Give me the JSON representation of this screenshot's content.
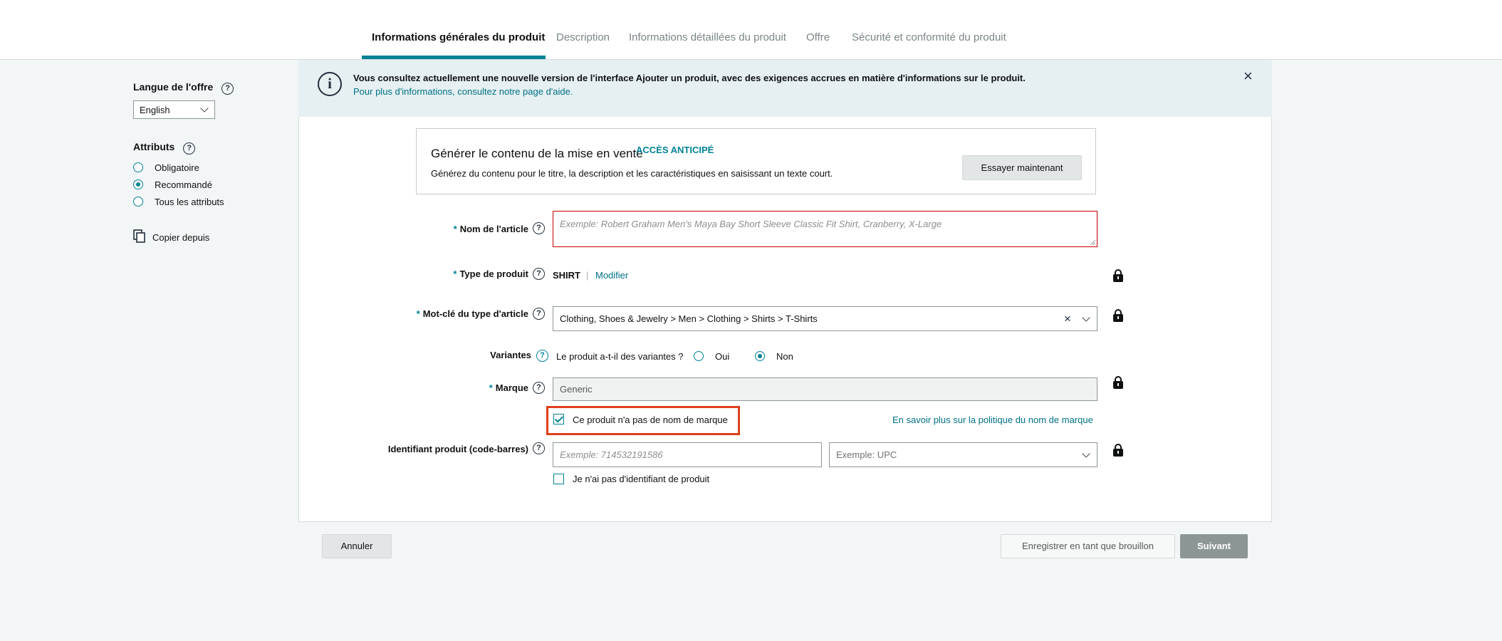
{
  "tabs": [
    {
      "label": "Informations générales du produit",
      "active": true
    },
    {
      "label": "Description"
    },
    {
      "label": "Informations détaillées du produit"
    },
    {
      "label": "Offre"
    },
    {
      "label": "Sécurité et conformité du produit"
    }
  ],
  "sidebar": {
    "language_title": "Langue de l'offre",
    "language_value": "English",
    "attributes_title": "Attributs",
    "attribute_options": [
      "Obligatoire",
      "Recommandé",
      "Tous les attributs"
    ],
    "attribute_selected": "Recommandé",
    "copy_label": "Copier depuis"
  },
  "banner": {
    "message": "Vous consultez actuellement une nouvelle version de l'interface Ajouter un produit, avec des exigences accrues en matière d'informations sur le produit.",
    "link": "Pour plus d'informations, consultez notre page d'aide.",
    "close": "×"
  },
  "generator": {
    "title": "Générer le contenu de la mise en vente",
    "badge": "ACCÈS ANTICIPÉ",
    "subtitle": "Générez du contenu pour le titre, la description et les caractéristiques en saisissant un texte court.",
    "button": "Essayer maintenant"
  },
  "form": {
    "required_mark": "*",
    "item_name": {
      "label": "Nom de l'article",
      "placeholder": "Exemple: Robert Graham Men's Maya Bay Short Sleeve Classic Fit Shirt, Cranberry, X-Large"
    },
    "product_type": {
      "label": "Type de produit",
      "value": "SHIRT",
      "separator": "|",
      "modify": "Modifier"
    },
    "keyword": {
      "label": "Mot-clé du type d'article",
      "value": "Clothing, Shoes & Jewelry > Men > Clothing > Shirts > T-Shirts",
      "clear": "×"
    },
    "variants": {
      "label": "Variantes",
      "question": "Le produit a-t-il des variantes ?",
      "yes": "Oui",
      "no": "Non",
      "selected": "Non"
    },
    "brand": {
      "label": "Marque",
      "value": "Generic",
      "no_brand_label": "Ce produit n'a pas de nom de marque",
      "no_brand_checked": true,
      "policy_link": "En savoir plus sur la politique du nom de marque"
    },
    "barcode": {
      "label": "Identifiant produit (code-barres)",
      "placeholder": "Exemple: 714532191586",
      "type_placeholder": "Exemple: UPC",
      "no_id_label": "Je n'ai pas d'identifiant de produit",
      "no_id_checked": false
    }
  },
  "footer": {
    "cancel": "Annuler",
    "draft": "Enregistrer en tant que brouillon",
    "next": "Suivant"
  },
  "colors": {
    "accent": "#008296",
    "link": "#007185",
    "highlight": "#e0401b",
    "error": "#c40000"
  }
}
